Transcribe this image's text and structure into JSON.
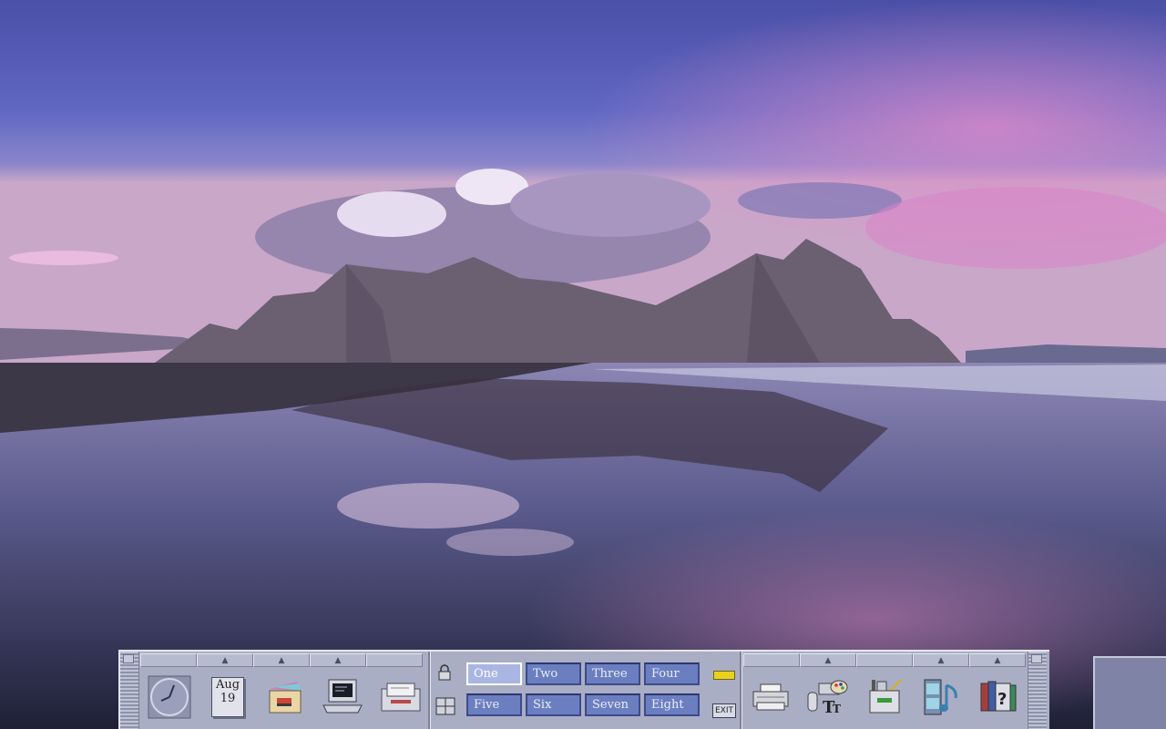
{
  "desktop": {
    "wallpaper": "mountain reflection at dusk"
  },
  "panel": {
    "calendar": {
      "month": "Aug",
      "day": "19"
    },
    "workspaces": [
      "One",
      "Two",
      "Three",
      "Four",
      "Five",
      "Six",
      "Seven",
      "Eight"
    ],
    "active_workspace": "One",
    "exit_label": "EXIT",
    "colors": {
      "panel": "#a9aec4",
      "workspace": "#6b7fc0",
      "workspace_active": "#aab6e2"
    },
    "left_icons": [
      "clock-icon",
      "calendar-icon",
      "file-manager-icon",
      "terminal-icon",
      "mailer-icon"
    ],
    "right_icons": [
      "printer-icon",
      "style-manager-icon",
      "app-manager-icon",
      "multimedia-icon",
      "help-icon"
    ]
  }
}
